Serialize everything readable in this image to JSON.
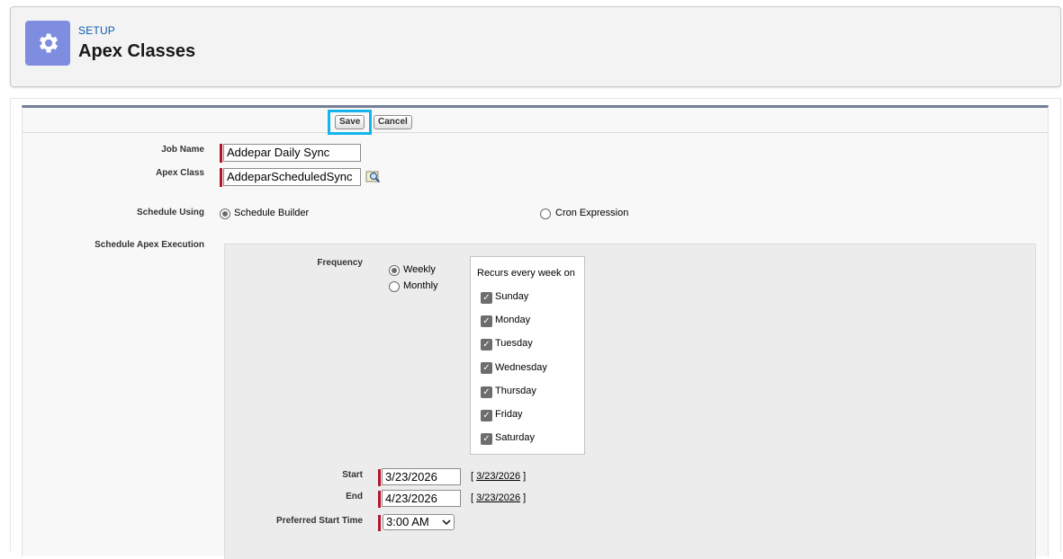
{
  "header": {
    "breadcrumb": "SETUP",
    "title": "Apex Classes",
    "icon": "gear-icon",
    "icon_color": "#7f8de1"
  },
  "buttons": {
    "save": "Save",
    "cancel": "Cancel",
    "highlight_color": "#13b5ea"
  },
  "fields": {
    "job_name_label": "Job Name",
    "job_name_value": "Addepar Daily Sync",
    "apex_class_label": "Apex Class",
    "apex_class_value": "AddeparScheduledSync",
    "lookup_icon": "lookup-search-icon"
  },
  "schedule_using": {
    "label": "Schedule Using",
    "options": [
      {
        "label": "Schedule Builder",
        "selected": true
      },
      {
        "label": "Cron Expression",
        "selected": false
      }
    ]
  },
  "execution": {
    "label": "Schedule Apex Execution",
    "frequency_label": "Frequency",
    "frequency_options": [
      {
        "label": "Weekly",
        "selected": true
      },
      {
        "label": "Monthly",
        "selected": false
      }
    ],
    "recurs_title": "Recurs every week on",
    "days": [
      {
        "label": "Sunday",
        "checked": true
      },
      {
        "label": "Monday",
        "checked": true
      },
      {
        "label": "Tuesday",
        "checked": true
      },
      {
        "label": "Wednesday",
        "checked": true
      },
      {
        "label": "Thursday",
        "checked": true
      },
      {
        "label": "Friday",
        "checked": true
      },
      {
        "label": "Saturday",
        "checked": true
      }
    ],
    "start_label": "Start",
    "start_value": "3/23/2026",
    "start_link": "3/23/2026",
    "end_label": "End",
    "end_value": "4/23/2026",
    "end_link": "3/23/2026",
    "time_label": "Preferred Start Time",
    "time_value": "3:00 AM",
    "bracket_open": "[",
    "bracket_close": "]"
  },
  "colors": {
    "required_bar": "#b3162c",
    "form_top_border": "#747e96",
    "link": "#0b5cab"
  }
}
